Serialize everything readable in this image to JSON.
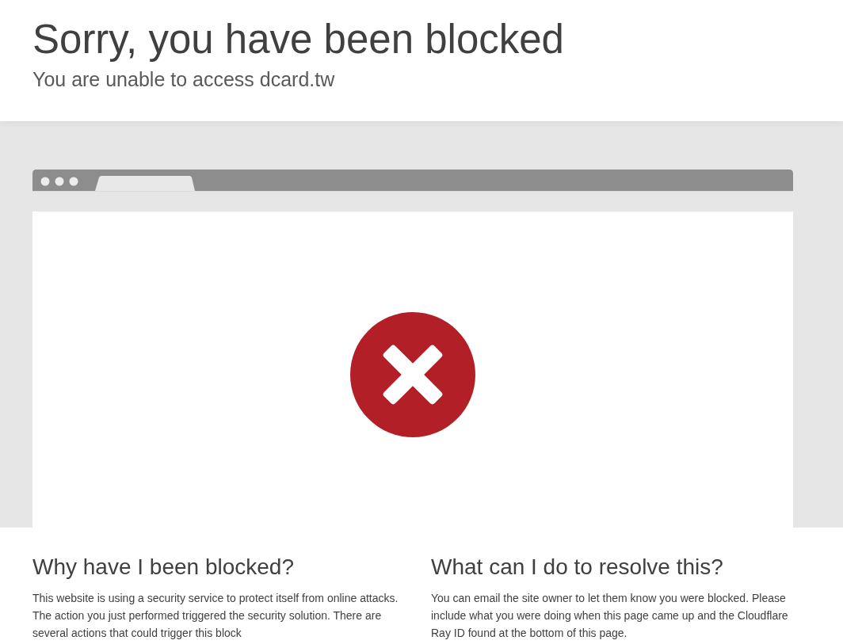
{
  "header": {
    "title": "Sorry, you have been blocked",
    "subtitle": "You are unable to access dcard.tw"
  },
  "sections": [
    {
      "heading": "Why have I been blocked?",
      "text": "This website is using a security service to protect itself from online attacks. The action you just performed triggered the security solution. There are several actions that could trigger this block"
    },
    {
      "heading": "What can I do to resolve this?",
      "text": "You can email the site owner to let them know you were blocked. Please include what you were doing when this page came up and the Cloudflare Ray ID found at the bottom of this page."
    }
  ]
}
